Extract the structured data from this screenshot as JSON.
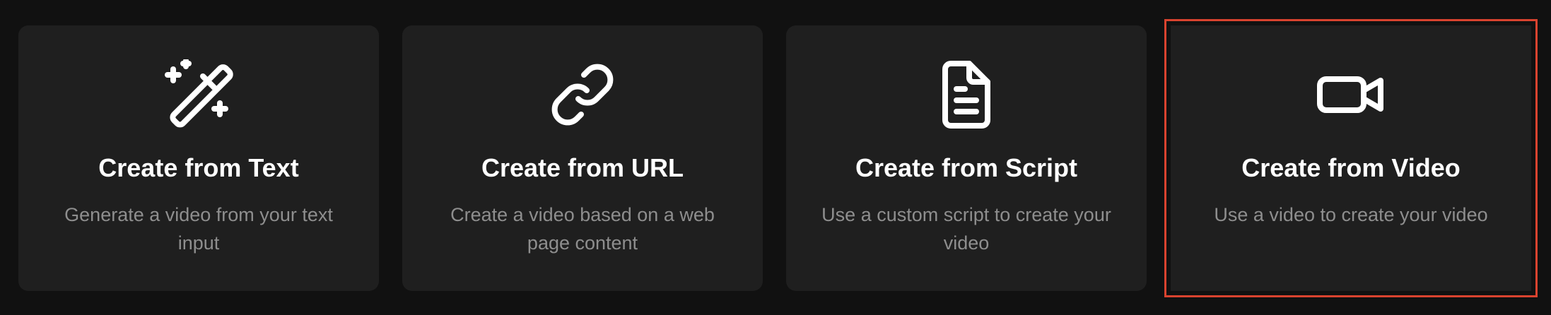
{
  "cards": [
    {
      "title": "Create from Text",
      "description": "Generate a video from your text input",
      "icon": "magic-wand-icon"
    },
    {
      "title": "Create from URL",
      "description": "Create a video based on a web page content",
      "icon": "link-icon"
    },
    {
      "title": "Create from Script",
      "description": "Use a custom script to create your video",
      "icon": "document-icon"
    },
    {
      "title": "Create from Video",
      "description": "Use a video to create your video",
      "icon": "video-camera-icon",
      "selected": true
    }
  ],
  "colors": {
    "background": "#111111",
    "card": "#1f1f1f",
    "title": "#ffffff",
    "description": "#8e8e8e",
    "selection": "#d9432f"
  }
}
